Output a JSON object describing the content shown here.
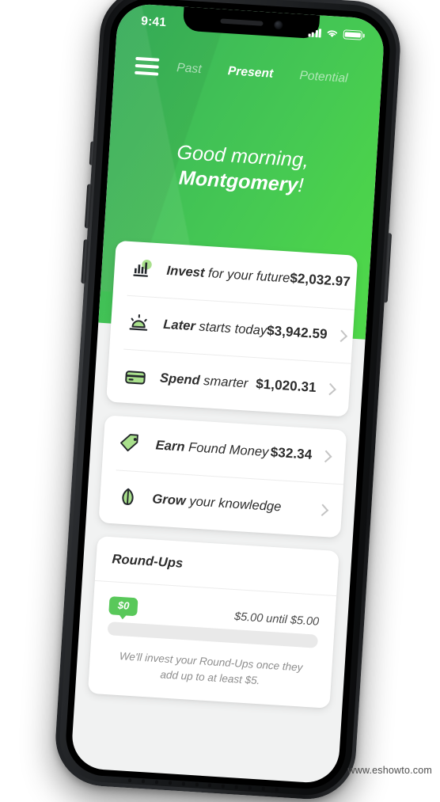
{
  "statusbar": {
    "time": "9:41",
    "signal_icon": "cellular-signal-icon",
    "wifi_icon": "wifi-icon",
    "battery_icon": "battery-icon"
  },
  "navbar": {
    "menu_icon": "hamburger-menu-icon",
    "tabs": [
      {
        "label": "Past",
        "active": false
      },
      {
        "label": "Present",
        "active": true
      },
      {
        "label": "Potential",
        "active": false
      }
    ]
  },
  "greeting": {
    "line1": "Good morning,",
    "name": "Montgomery",
    "punctuation": "!"
  },
  "cards": {
    "primary": [
      {
        "icon": "bar-chart-icon",
        "label_bold": "Invest",
        "label_rest": " for your future",
        "amount": "$2,032.97",
        "chevron": "chevron-right-icon"
      },
      {
        "icon": "sunrise-icon",
        "label_bold": "Later",
        "label_rest": " starts today",
        "amount": "$3,942.59",
        "chevron": "chevron-right-icon"
      },
      {
        "icon": "credit-card-icon",
        "label_bold": "Spend",
        "label_rest": " smarter",
        "amount": "$1,020.31",
        "chevron": "chevron-right-icon"
      }
    ],
    "secondary": [
      {
        "icon": "price-tag-icon",
        "label_bold": "Earn",
        "label_rest": " Found Money",
        "amount": "$32.34",
        "chevron": "chevron-right-icon"
      },
      {
        "icon": "leaf-icon",
        "label_bold": "Grow",
        "label_rest": " your knowledge",
        "amount": "",
        "chevron": "chevron-right-icon"
      }
    ]
  },
  "roundups": {
    "title": "Round-Ups",
    "badge": "$0",
    "until_text": "$5.00 until $5.00",
    "progress_percent": 0,
    "note": "We'll invest your Round-Ups once they add up to at least $5."
  },
  "watermark": "www.eshowto.com",
  "colors": {
    "green_start": "#36b25c",
    "green_end": "#4fd84a",
    "badge_green": "#59c85a",
    "icon_accent": "#a9e08c",
    "text_dark": "#2c2c2c",
    "text_muted": "#8d8d8d",
    "chevron": "#c4c4c4",
    "screen_bg": "#f1f2f2"
  }
}
